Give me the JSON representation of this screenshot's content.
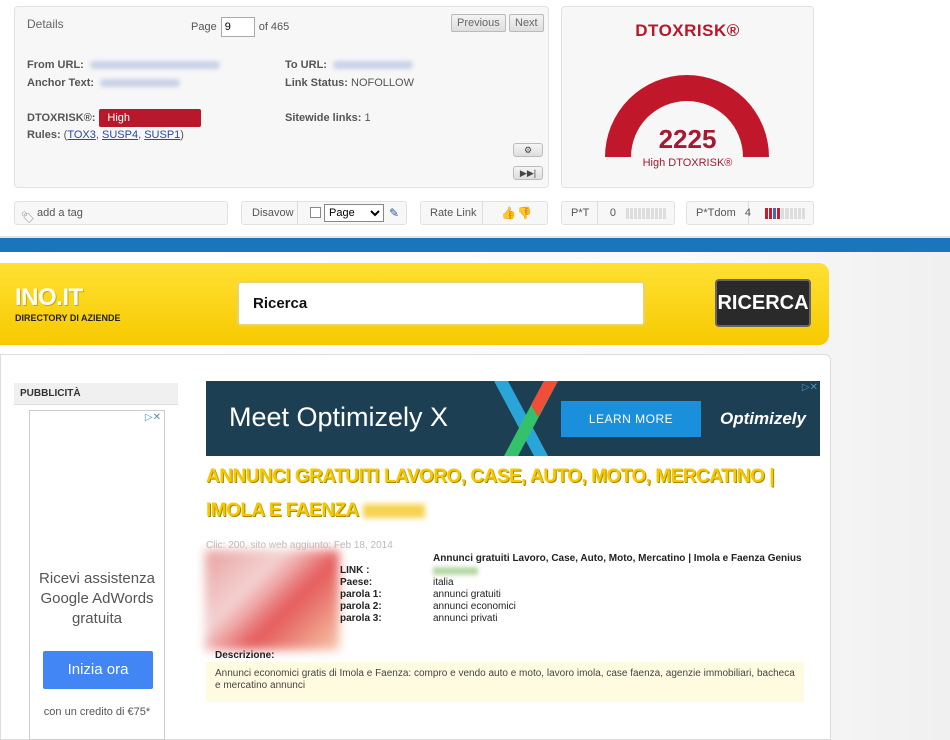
{
  "details": {
    "title": "Details",
    "page_label": "Page",
    "page_value": "9",
    "page_of": "of 465",
    "prev_label": "Previous",
    "next_label": "Next",
    "from_url_label": "From URL:",
    "anchor_label": "Anchor Text:",
    "to_url_label": "To URL:",
    "link_status_label": "Link Status:",
    "link_status_value": "NOFOLLOW",
    "dtoxrisk_label": "DTOXRISK®:",
    "dtoxrisk_badge": "High",
    "sitewide_label": "Sitewide links:",
    "sitewide_value": "1",
    "rules_label": "Rules:",
    "rules": [
      "TOX3",
      "SUSP4",
      "SUSP1"
    ],
    "settings_icon": "gear-icon",
    "fast_forward_icon": "fast-forward-icon"
  },
  "gauge": {
    "title": "DTOXRISK®",
    "value": "2225",
    "label": "High DTOXRISK®",
    "color": "#b7182a"
  },
  "toolbar": {
    "tag_placeholder": "add a tag",
    "disavow_label": "Disavow",
    "disavow_select": "Page",
    "rate_label": "Rate Link",
    "pt_label": "P*T",
    "pt_value": "0",
    "ptdom_label": "P*Tdom",
    "ptdom_value": "4"
  },
  "site": {
    "logo": "INO.IT",
    "logo_sub": "DIRECTORY DI AZIENDE",
    "search_placeholder": "Ricerca",
    "search_button": "RICERCA",
    "side_title": "PUBBLICITÀ",
    "side_ad_text": "Ricevi assistenza Google AdWords gratuita",
    "side_ad_button": "Inizia ora",
    "side_ad_footer": "con un credito di €75*",
    "banner_title": "Meet Optimizely X",
    "banner_button": "LEARN MORE",
    "banner_brand": "Optimizely",
    "listing_title": "ANNUNCI GRATUITI LAVORO, CASE, AUTO, MOTO, MERCATINO | IMOLA E FAENZA",
    "meta": "Clic: 200, sito web aggiunto: Feb 18, 2014",
    "info_head": "Annunci gratuiti Lavoro, Case, Auto, Moto, Mercatino | Imola e Faenza Genius",
    "info": [
      {
        "k": "LINK :",
        "v": ""
      },
      {
        "k": "Paese:",
        "v": "italia"
      },
      {
        "k": "parola 1:",
        "v": "annunci gratuiti"
      },
      {
        "k": "parola 2:",
        "v": "annunci economici"
      },
      {
        "k": "parola 3:",
        "v": "annunci privati"
      }
    ],
    "desc_label": "Descrizione:",
    "desc_text": "Annunci economici gratis di Imola e Faenza: compro e vendo auto e moto, lavoro imola, case faenza, agenzie immobiliari, bacheca e mercatino annunci"
  }
}
